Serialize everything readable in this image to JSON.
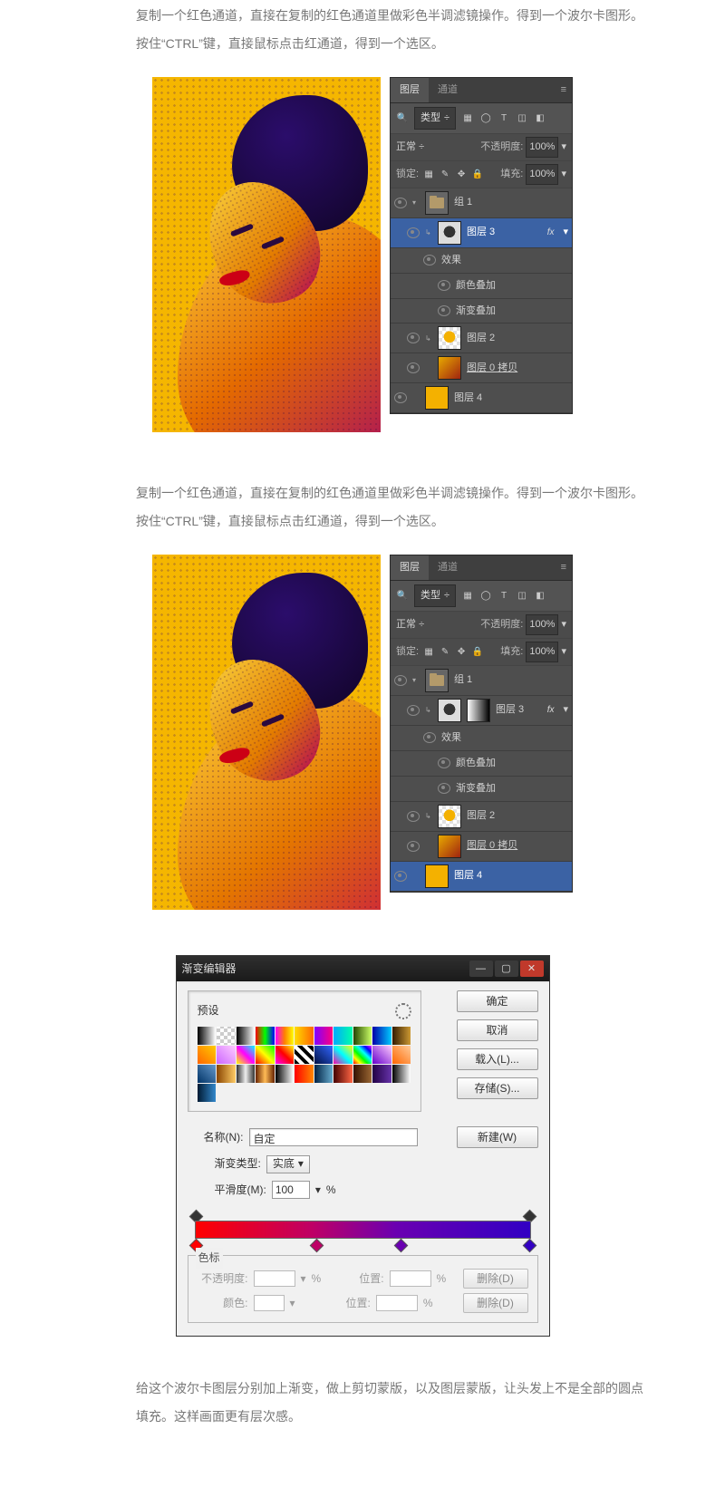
{
  "para1": {
    "l1": "复制一个红色通道，直接在复制的红色通道里做彩色半调滤镜操作。得到一个波尔卡图形。",
    "l2": "按住“CTRL”键，直接鼠标点击红通道，得到一个选区。"
  },
  "para2": {
    "l1": "复制一个红色通道，直接在复制的红色通道里做彩色半调滤镜操作。得到一个波尔卡图形。",
    "l2": "按住“CTRL”键，直接鼠标点击红通道，得到一个选区。"
  },
  "para3": {
    "l1": "给这个波尔卡图层分别加上渐变，做上剪切蒙版，以及图层蒙版，让头发上不是全部的圆点",
    "l2": "填充。这样画面更有层次感。"
  },
  "layers": {
    "tab_layers": "图层",
    "tab_channels": "通道",
    "menu_glyph": "≡",
    "type_label": "类型",
    "sort_glyph": "÷",
    "filter_glyphs": [
      "▦",
      "◯",
      "T",
      "◫",
      "◧"
    ],
    "blend": "正常",
    "opacity_label": "不透明度:",
    "opacity_val": "100%",
    "lock_label": "锁定:",
    "lock_glyphs": [
      "▦",
      "✎",
      "✥",
      "🔒"
    ],
    "fill_label": "填充:",
    "fill_val": "100%",
    "group": "组 1",
    "l3": "图层 3",
    "fx": "fx",
    "effects": "效果",
    "coloroverlay": "颜色叠加",
    "gradoverlay": "渐变叠加",
    "l2": "图层 2",
    "l0copy": "图层 0 拷贝",
    "l4": "图层 4"
  },
  "dlg": {
    "title": "渐变编辑器",
    "presets": "预设",
    "ok": "确定",
    "cancel": "取消",
    "load": "载入(L)...",
    "save": "存储(S)...",
    "new": "新建(W)",
    "name_label": "名称(N):",
    "name_val": "自定",
    "gradtype_label": "渐变类型:",
    "gradtype_val": "实底",
    "smooth_label": "平滑度(M):",
    "smooth_val": "100",
    "percent": "%",
    "marks_title": "色标",
    "opac_lbl": "不透明度:",
    "color_lbl": "颜色:",
    "pos_lbl": "位置:",
    "delete": "删除(D)"
  },
  "swatch_colors": [
    "linear-gradient(90deg,#000,#fff)",
    "repeating-conic-gradient(#ccc 0 25%,#fff 0 50%) 0/8px 8px",
    "linear-gradient(90deg,#000,#fff)",
    "linear-gradient(90deg,#ff0000,#00ff00,#0000ff)",
    "linear-gradient(90deg,#ff00ff,#ff8000,#ffff00)",
    "linear-gradient(90deg,#ffdd00,#ff6600)",
    "linear-gradient(90deg,#8000ff,#ff0080)",
    "linear-gradient(90deg,#00aaff,#00ffaa)",
    "linear-gradient(90deg,#224400,#ccff66)",
    "linear-gradient(90deg,#0000aa,#00ccff)",
    "linear-gradient(90deg,#331a00,#cc9933)",
    "linear-gradient(45deg,#ff6600,#ffcc00)",
    "linear-gradient(45deg,#cc66ff,#ffccff)",
    "linear-gradient(45deg,#ffff00,#ff00ff,#00ffff)",
    "linear-gradient(45deg,#ff0000,#ffff00,#00ff00)",
    "linear-gradient(45deg,#ff00ff,#ff0000,#ffff00)",
    "repeating-linear-gradient(45deg,#000 0 4px,#fff 4px 8px)",
    "linear-gradient(45deg,#001144,#3366ff)",
    "linear-gradient(45deg,#ff00aa,#00ffff,#ffff00)",
    "linear-gradient(45deg,#ff0000,#ffff00,#00ff00,#00ffff,#0000ff,#ff00ff)",
    "linear-gradient(45deg,#6600cc,#ffccff)",
    "linear-gradient(45deg,#ff6600,#ffcc99)",
    "linear-gradient(45deg,#003366,#6699cc)",
    "linear-gradient(90deg,#884400,#ffcc66)",
    "linear-gradient(90deg,#333,#eee,#333)",
    "linear-gradient(90deg,#662200,#ffbb55,#662200)",
    "linear-gradient(90deg,#000,#fff)",
    "linear-gradient(90deg,#ff0000,#ff8800)",
    "linear-gradient(90deg,#002244,#66aacc)",
    "linear-gradient(90deg,#440000,#ff6644)",
    "linear-gradient(90deg,#331100,#996633)",
    "linear-gradient(90deg,#220044,#6633aa)",
    "linear-gradient(90deg,#000,#fff)",
    "linear-gradient(90deg,#001a33,#3388cc)"
  ]
}
